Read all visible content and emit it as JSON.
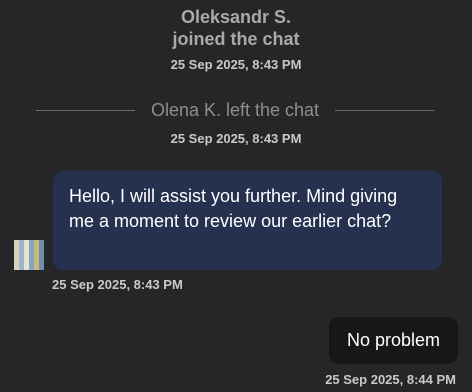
{
  "system_join": {
    "name": "Oleksandr S.",
    "action": "joined the chat",
    "timestamp": "25 Sep 2025, 8:43 PM"
  },
  "system_left": {
    "text": "Olena K. left the chat",
    "timestamp": "25 Sep 2025, 8:43 PM"
  },
  "messages": [
    {
      "direction": "incoming",
      "text": "Hello, I will assist you further. Mind giving me a moment to review our earlier chat?",
      "timestamp": "25 Sep 2025, 8:43 PM"
    },
    {
      "direction": "outgoing",
      "text": "No problem",
      "timestamp": "25 Sep 2025, 8:44 PM"
    }
  ],
  "colors": {
    "background": "#262628",
    "incoming_bubble": "#263150",
    "outgoing_bubble": "#17171a",
    "system_text": "#a9a9ab",
    "timestamp_text": "#c9c9cb"
  },
  "avatar": {
    "icon": "striped-avatar-icon",
    "stripe_colors": [
      "#d9d2b8",
      "#9bb8c9",
      "#e8e2cf",
      "#7fa7c0",
      "#c9b77e",
      "#6e8fa8"
    ]
  }
}
